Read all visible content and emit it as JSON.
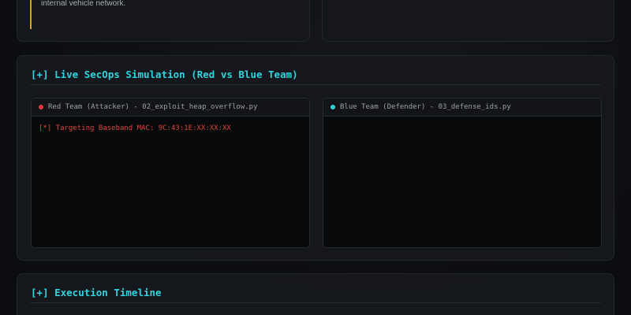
{
  "top_panel": {
    "callout_text": "boundaries separating the external communication interfaces from the internal vehicle network."
  },
  "simulation": {
    "title": "[+] Live SecOps Simulation (Red vs Blue Team)",
    "red_team": {
      "title": "Red Team (Attacker) - 02_exploit_heap_overflow.py",
      "dot_color": "#e03a3a",
      "log_color": "#d9483b",
      "logs": [
        "[*] Targeting Baseband MAC: 9C:43:1E:XX:XX:XX"
      ]
    },
    "blue_team": {
      "title": "Blue Team (Defender) - 03_defense_ids.py",
      "dot_color": "#2fd4df",
      "logs": []
    }
  },
  "timeline": {
    "title": "[+] Execution Timeline"
  },
  "colors": {
    "accent": "#2fd4df",
    "warning_border": "#d9a32a"
  }
}
